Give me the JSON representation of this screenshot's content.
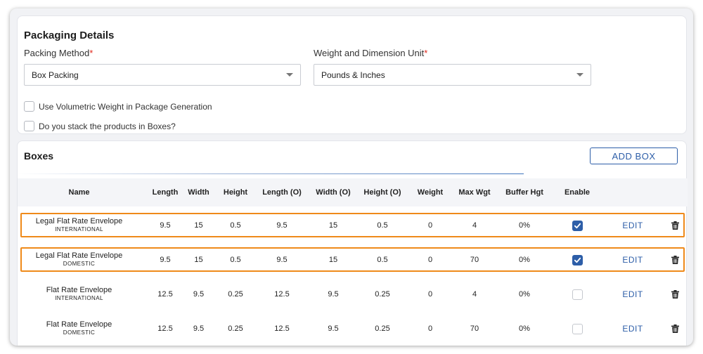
{
  "packaging": {
    "title": "Packaging Details",
    "method_label": "Packing Method",
    "method_value": "Box Packing",
    "unit_label": "Weight and Dimension Unit",
    "unit_value": "Pounds & Inches",
    "required_mark": "*",
    "volumetric_label": "Use Volumetric Weight in Package Generation",
    "volumetric_checked": false,
    "stack_label": "Do you stack the products in Boxes?",
    "stack_checked": false
  },
  "boxes": {
    "title": "Boxes",
    "add_button": "ADD BOX",
    "columns": [
      "Name",
      "Length",
      "Width",
      "Height",
      "Length (O)",
      "Width (O)",
      "Height (O)",
      "Weight",
      "Max Wgt",
      "Buffer Hgt",
      "Enable"
    ],
    "edit_label": "EDIT",
    "rows": [
      {
        "name": "Legal Flat Rate Envelope",
        "sub": "INTERNATIONAL",
        "length": "9.5",
        "width": "15",
        "height": "0.5",
        "length_o": "9.5",
        "width_o": "15",
        "height_o": "0.5",
        "weight": "0",
        "max_wgt": "4",
        "buffer_hgt": "0%",
        "enabled": true,
        "highlighted": true
      },
      {
        "name": "Legal Flat Rate Envelope",
        "sub": "DOMESTIC",
        "length": "9.5",
        "width": "15",
        "height": "0.5",
        "length_o": "9.5",
        "width_o": "15",
        "height_o": "0.5",
        "weight": "0",
        "max_wgt": "70",
        "buffer_hgt": "0%",
        "enabled": true,
        "highlighted": true
      },
      {
        "name": "Flat Rate Envelope",
        "sub": "INTERNATIONAL",
        "length": "12.5",
        "width": "9.5",
        "height": "0.25",
        "length_o": "12.5",
        "width_o": "9.5",
        "height_o": "0.25",
        "weight": "0",
        "max_wgt": "4",
        "buffer_hgt": "0%",
        "enabled": false,
        "highlighted": false
      },
      {
        "name": "Flat Rate Envelope",
        "sub": "DOMESTIC",
        "length": "12.5",
        "width": "9.5",
        "height": "0.25",
        "length_o": "12.5",
        "width_o": "9.5",
        "height_o": "0.25",
        "weight": "0",
        "max_wgt": "70",
        "buffer_hgt": "0%",
        "enabled": false,
        "highlighted": false
      }
    ]
  },
  "colors": {
    "accent": "#2d5ea8",
    "highlight": "#ef8a1a",
    "required": "#e0281c"
  }
}
